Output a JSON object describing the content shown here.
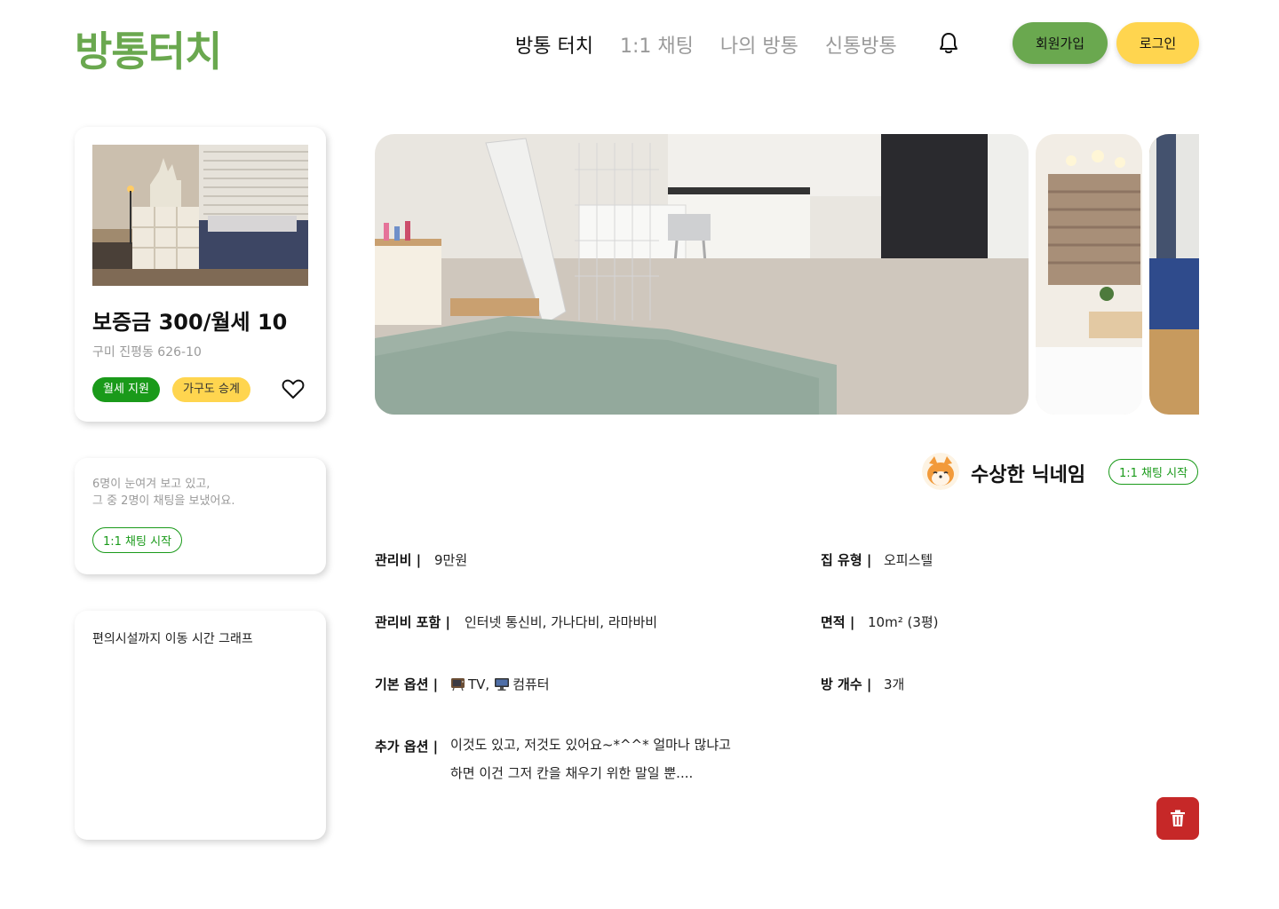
{
  "header": {
    "logo": "방통터치",
    "nav": [
      "방통 터치",
      "1:1 채팅",
      "나의 방통",
      "신통방통"
    ],
    "signup_label": "회원가입",
    "login_label": "로그인"
  },
  "listing": {
    "price": "보증금 300/월세 10",
    "address": "구미 진평동 626-10",
    "tags": [
      "월세 지원",
      "가구도 승계"
    ]
  },
  "viewers": {
    "line1": "6명이 눈여겨 보고 있고,",
    "line2": "그 중 2명이 채팅을 보냈어요.",
    "chat_label": "1:1 채팅 시작"
  },
  "graph": {
    "title": "편의시설까지 이동 시간 그래프"
  },
  "owner": {
    "nickname": "수상한 닉네임",
    "chat_label": "1:1 채팅 시작"
  },
  "details": {
    "fee_label": "관리비 |",
    "fee_value": "9만원",
    "type_label": "집 유형 |",
    "type_value": "오피스텔",
    "fee_incl_label": "관리비 포함 |",
    "fee_incl_value": "인터넷 통신비, 가나다비, 라마바비",
    "area_label": "면적 |",
    "area_value": "10m² (3평)",
    "basic_label": "기본 옵션 |",
    "basic_tv": "TV,",
    "basic_pc": "컴퓨터",
    "rooms_label": "방 개수 |",
    "rooms_value": "3개",
    "extra_label": "추가 옵션 |",
    "extra_line1": "이것도 있고, 저것도 있어요~*^^* 얼마나 많냐고",
    "extra_line2": "하면 이건 그저 칸을 채우기 위한 말일 뿐...."
  },
  "colors": {
    "brand_green": "#6aa84f",
    "accent_green": "#1a9a1a",
    "accent_yellow": "#ffd54f",
    "danger": "#c62828"
  },
  "icons": [
    "bell-icon",
    "heart-icon",
    "trash-icon",
    "tv-icon",
    "computer-icon"
  ]
}
